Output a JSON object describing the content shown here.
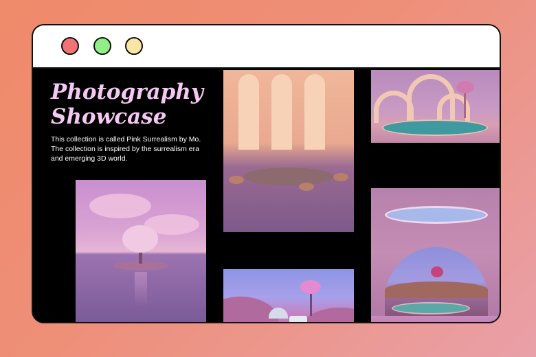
{
  "window": {
    "controls": [
      "close",
      "maximize",
      "minimize"
    ]
  },
  "showcase": {
    "title_line1": "Photography",
    "title_line2": "Showcase",
    "description": "This collection is called Pink Surrealism by Mo.  The collection is inspired by the surrealism era and emerging 3D world."
  },
  "colors": {
    "title": "#f4c8f2",
    "window_bg": "#000000",
    "titlebar_bg": "#ffffff",
    "close": "#f07476",
    "maximize": "#8fee85",
    "minimize": "#f9e5a4"
  },
  "gallery": [
    {
      "name": "tree-island-photo"
    },
    {
      "name": "curtain-arches-photo"
    },
    {
      "name": "pool-arches-photo"
    },
    {
      "name": "dome-palm-photo"
    },
    {
      "name": "skylight-arch-photo"
    }
  ]
}
